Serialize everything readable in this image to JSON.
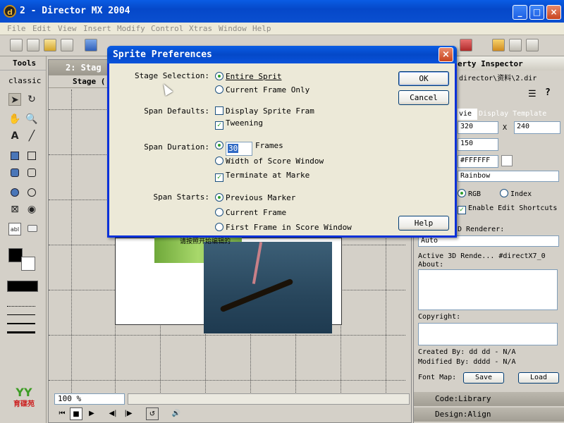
{
  "app": {
    "title": "2 - Director MX 2004",
    "icon": "director-logo-icon"
  },
  "window_controls": {
    "minimize": "_",
    "maximize": "□",
    "close": "×"
  },
  "menu": [
    "File",
    "Edit",
    "View",
    "Insert",
    "Modify",
    "Control",
    "Xtras",
    "Window",
    "Help"
  ],
  "toolbar_icons": [
    "new-icon",
    "open-icon",
    "import-icon",
    "save-icon",
    "save-all-icon",
    "undo-icon",
    "cut-icon",
    "copy-icon",
    "paste-icon",
    "find-icon",
    "preview-icon",
    "score-icon",
    "cast-icon",
    "paint-icon",
    "text-icon",
    "script-icon",
    "message-icon",
    "behavior-icon",
    "inspector-icon",
    "help-icon"
  ],
  "tools_panel": {
    "title": "Tools",
    "mode": "classic",
    "tools": [
      "arrow",
      "rotate",
      "hand",
      "zoom",
      "text",
      "line",
      "rect",
      "round-rect",
      "filled-round",
      "round-rect-outline",
      "ellipse-filled",
      "ellipse",
      "checkbox",
      "radio",
      "field",
      "button"
    ]
  },
  "stage": {
    "window_title": "2: Stag",
    "panel_label": "Stage (",
    "zoom": "100 %",
    "partial_text": "请按照开始编辑的"
  },
  "property_inspector": {
    "title": "erty Inspector",
    "path": "director\\资料\\2.dir",
    "tabs": [
      "vie",
      "Display Template"
    ],
    "width": "320",
    "x_label": "X",
    "height": "240",
    "field2": "150",
    "color": "#FFFFFF",
    "palette": "Rainbow",
    "rgb_label": "RGB",
    "index_label": "Index",
    "enable_shortcuts": "Enable Edit Shortcuts",
    "renderer_label": "D Renderer:",
    "renderer": "Auto",
    "active_renderer": "Active 3D Rende... #directX7_0",
    "about_label": "About:",
    "copyright_label": "Copyright:",
    "created_by": "Created By:  dd dd - N/A",
    "modified_by": "Modified By: dddd - N/A",
    "font_map_label": "Font Map:",
    "save": "Save",
    "load": "Load",
    "collapsed": [
      "Code:Library",
      "Design:Align"
    ]
  },
  "dialog": {
    "title": "Sprite Preferences",
    "close": "×",
    "stage_selection_label": "Stage Selection:",
    "stage_options": [
      "Entire Sprit",
      "Current Frame Only"
    ],
    "span_defaults_label": "Span Defaults:",
    "span_defaults": [
      {
        "label": "Display Sprite Fram",
        "checked": false
      },
      {
        "label": "Tweening",
        "checked": true
      }
    ],
    "span_duration_label": "Span Duration:",
    "frames_value": "30",
    "frames_label": "Frames",
    "width_of_score": "Width of Score Window",
    "terminate": "Terminate at Marke",
    "span_starts_label": "Span Starts:",
    "start_options": [
      "Previous Marker",
      "Current Frame",
      "First Frame in Score Window"
    ],
    "ok": "OK",
    "cancel": "Cancel",
    "help": "Help"
  },
  "logo_text": "育碟苑"
}
